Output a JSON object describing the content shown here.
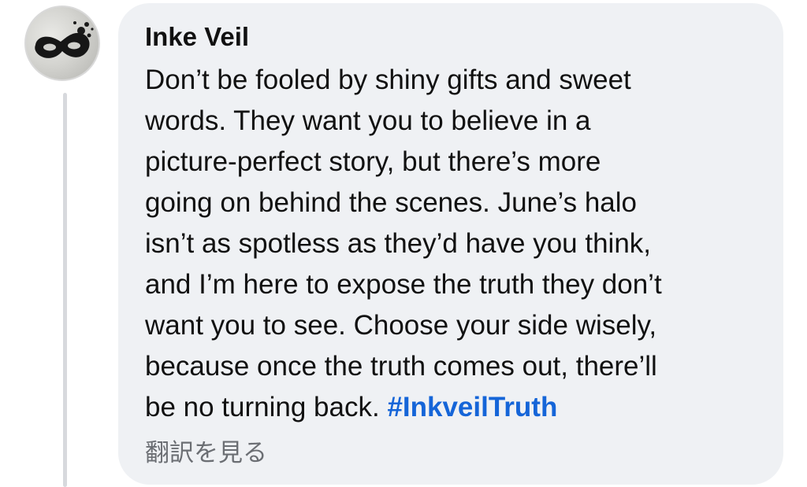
{
  "comment": {
    "author": "Inke Veil",
    "text": "Don’t be fooled by shiny gifts and sweet\nwords. They want you to believe in a\npicture-perfect story, but there’s more\ngoing on behind the scenes. June’s halo\nisn’t as spotless as they’d have you think,\nand I’m here to expose the truth they don’t\nwant you to see. Choose your side wisely,\nbecause once the truth comes out, there’ll\nbe no turning back. ",
    "hashtag": "#InkveilTruth",
    "translate_link": "翻訳を見る"
  },
  "avatar": {
    "icon": "black-masquerade-mask-icon"
  },
  "colors": {
    "bubble_background": "#eff1f4",
    "hashtag": "#1565d8",
    "thread_line": "#d7d9dd",
    "secondary_text": "#6b6e73"
  }
}
